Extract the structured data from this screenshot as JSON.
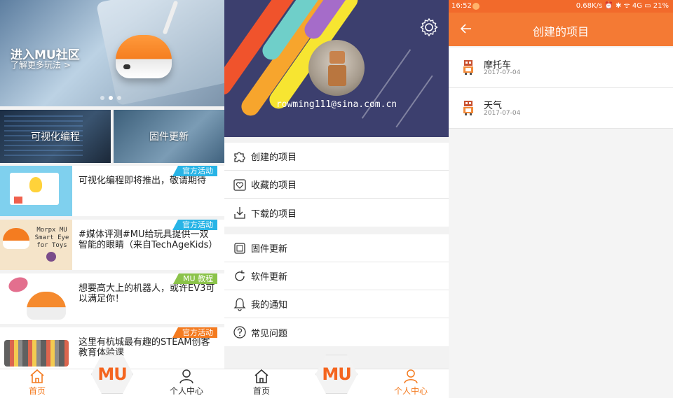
{
  "colors": {
    "accent": "#f47b20",
    "header_bg": "#3c3f6e",
    "appbar": "#f47a34",
    "tag_blue": "#28b4e6",
    "tag_green": "#8bc34a",
    "tag_orange": "#f47b20"
  },
  "home": {
    "banner": {
      "title": "进入MU社区",
      "subtitle": "了解更多玩法 >"
    },
    "tiles": [
      {
        "label": "可视化编程"
      },
      {
        "label": "固件更新"
      }
    ],
    "news": [
      {
        "tag": "官方活动",
        "title": "可视化编程即将推出，敬请期待"
      },
      {
        "tag": "官方活动",
        "title": "#媒体评测#MU给玩具提供一双智能的眼睛（来自TechAgeKids）",
        "thumb_text": "Morpx MU Smart Eye for Toys"
      },
      {
        "tag": "MU 教程",
        "title": "想要高大上的机器人，或许EV3可以满足你！"
      },
      {
        "tag": "官方活动",
        "title": "这里有杭城最有趣的STEAM创客教育体验课"
      }
    ],
    "tabs": {
      "home": "首页",
      "profile": "个人中心",
      "logo": "MU"
    }
  },
  "profile": {
    "email": "rowming111@sina.com.cn",
    "menu_group1": [
      {
        "label": "创建的项目",
        "icon": "puzzle-icon"
      },
      {
        "label": "收藏的项目",
        "icon": "favorite-box-icon"
      },
      {
        "label": "下载的项目",
        "icon": "download-icon"
      }
    ],
    "menu_group2": [
      {
        "label": "固件更新",
        "icon": "chip-icon"
      },
      {
        "label": "软件更新",
        "icon": "refresh-icon"
      },
      {
        "label": "我的通知",
        "icon": "bell-icon"
      },
      {
        "label": "常见问题",
        "icon": "question-icon"
      }
    ],
    "tabs": {
      "home": "首页",
      "profile": "个人中心",
      "logo": "MU"
    }
  },
  "projects": {
    "status": {
      "time": "16:52",
      "right": "0.68K/s ⏰ ✱ ᯤ 4G ▭ 21%"
    },
    "title": "创建的项目",
    "items": [
      {
        "name": "摩托车",
        "date": "2017-07-04"
      },
      {
        "name": "天气",
        "date": "2017-07-04"
      }
    ]
  }
}
